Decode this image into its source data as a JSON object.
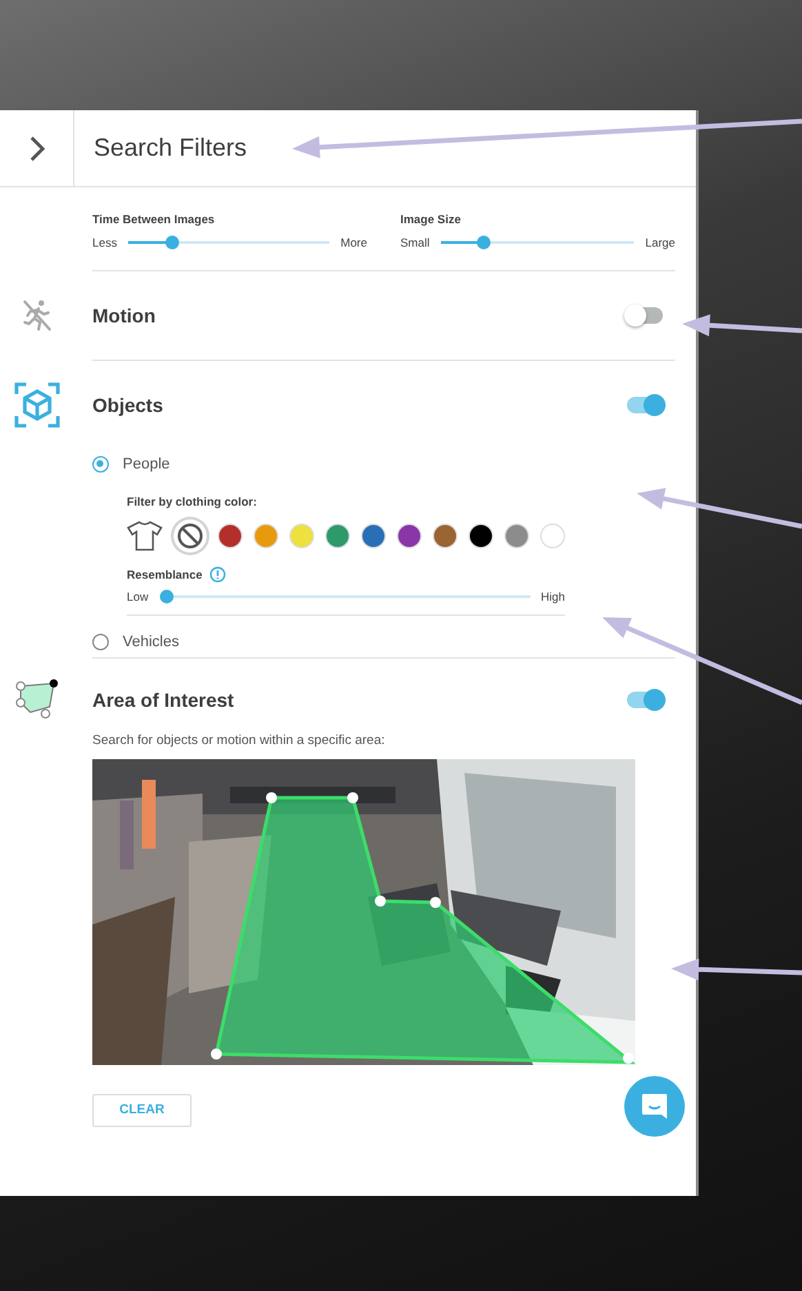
{
  "header": {
    "title": "Search Filters"
  },
  "image_sliders": [
    {
      "label": "Time Between Images",
      "min": "Less",
      "max": "More",
      "level": 0.2
    },
    {
      "label": "Image Size",
      "min": "Small",
      "max": "Large",
      "level": 0.2
    }
  ],
  "sections": [
    {
      "kind": "motion",
      "title": "Motion",
      "on": false
    },
    {
      "kind": "objects",
      "title": "Objects",
      "on": true,
      "options": [
        {
          "label": "People",
          "selected": true
        },
        {
          "label": "Vehicles",
          "selected": false
        }
      ],
      "clothing_filter": {
        "label": "Filter by clothing color:",
        "swatches": [
          {
            "kind": "none",
            "selected": true
          },
          {
            "kind": "color",
            "color": "#b3302a",
            "selected": false
          },
          {
            "kind": "color",
            "color": "#e89a0e",
            "selected": false
          },
          {
            "kind": "color",
            "color": "#ece13e",
            "selected": false
          },
          {
            "kind": "color",
            "color": "#2e9a6a",
            "selected": false
          },
          {
            "kind": "color",
            "color": "#2a6fb5",
            "selected": false
          },
          {
            "kind": "color",
            "color": "#8a35a8",
            "selected": false
          },
          {
            "kind": "color",
            "color": "#9a6433",
            "selected": false
          },
          {
            "kind": "color",
            "color": "#000000",
            "selected": false
          },
          {
            "kind": "color",
            "color": "#8c8c8c",
            "selected": false
          },
          {
            "kind": "color",
            "color": "#ffffff",
            "selected": false
          }
        ]
      },
      "resemblance": {
        "label": "Resemblance",
        "min": "Low",
        "max": "High",
        "level": 0.0
      }
    },
    {
      "kind": "area",
      "title": "Area of Interest",
      "on": true,
      "hint": "Search for objects or motion within a specific area:",
      "clear_button": "CLEAR"
    }
  ]
}
